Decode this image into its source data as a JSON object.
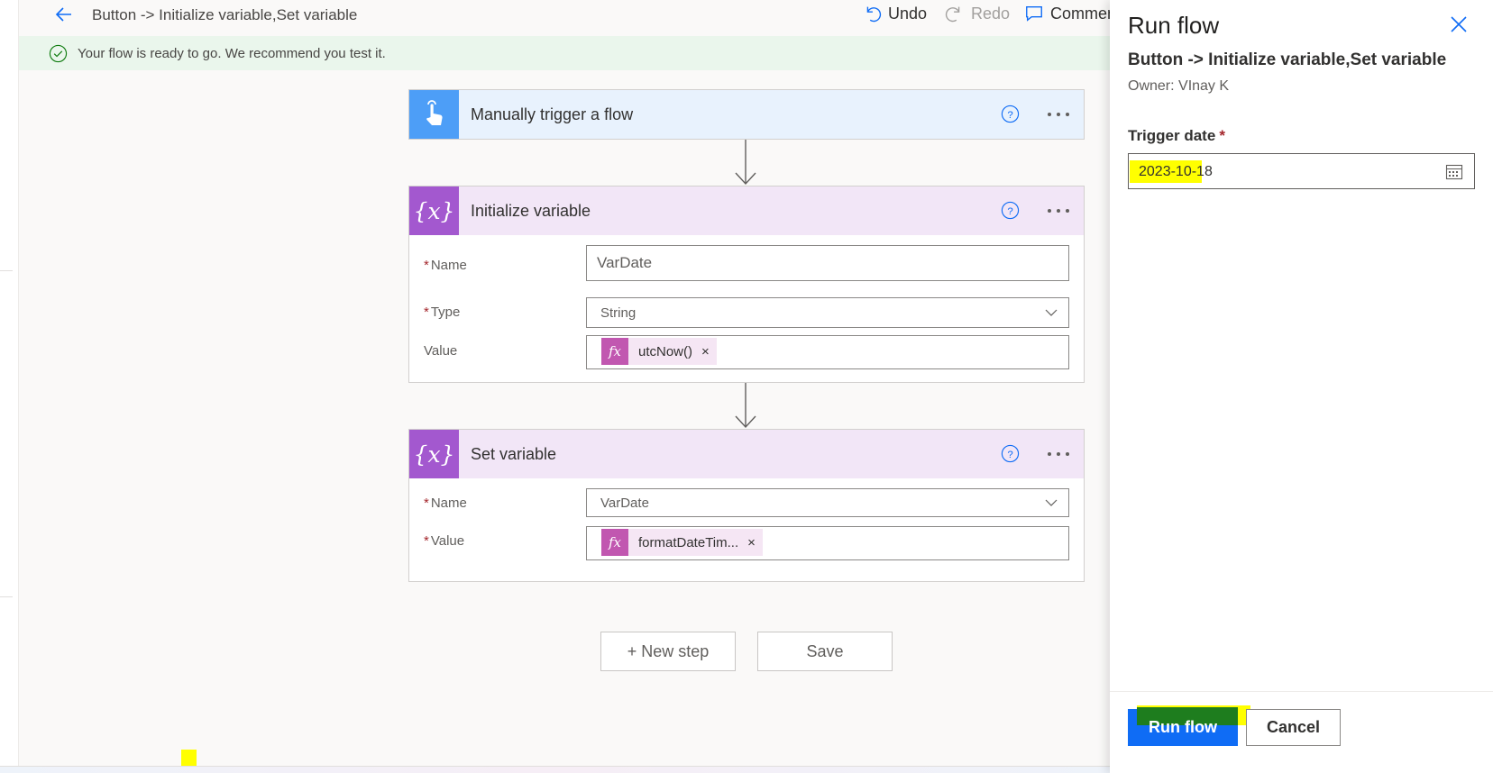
{
  "header": {
    "flow_title": "Button -> Initialize variable,Set variable",
    "undo_label": "Undo",
    "redo_label": "Redo",
    "comments_label": "Commen"
  },
  "banner": {
    "message": "Your flow is ready to go. We recommend you test it."
  },
  "trigger_card": {
    "title": "Manually trigger a flow"
  },
  "init_card": {
    "title": "Initialize variable",
    "name_label": "Name",
    "name_value": "VarDate",
    "type_label": "Type",
    "type_value": "String",
    "value_label": "Value",
    "value_token": "utcNow()"
  },
  "set_card": {
    "title": "Set variable",
    "name_label": "Name",
    "name_value": "VarDate",
    "value_label": "Value",
    "value_token": "formatDateTim..."
  },
  "canvas_actions": {
    "new_step_label": "+ New step",
    "save_label": "Save"
  },
  "panel": {
    "title": "Run flow",
    "flow_name": "Button -> Initialize variable,Set variable",
    "owner": "Owner: VInay K",
    "trigger_date_label": "Trigger date",
    "trigger_date_value": "2023-10-18",
    "run_label": "Run flow",
    "cancel_label": "Cancel"
  },
  "token_symbol": "fx",
  "required_mark": "*",
  "token_remove": "×",
  "colors": {
    "trigger_accent": "#4d9ef7",
    "variable_accent": "#a358cf",
    "expression_accent": "#c157b0",
    "primary_button": "#0f6cf5",
    "highlight_yellow": "#ffff00",
    "banner_bg": "#eaf6ec"
  }
}
